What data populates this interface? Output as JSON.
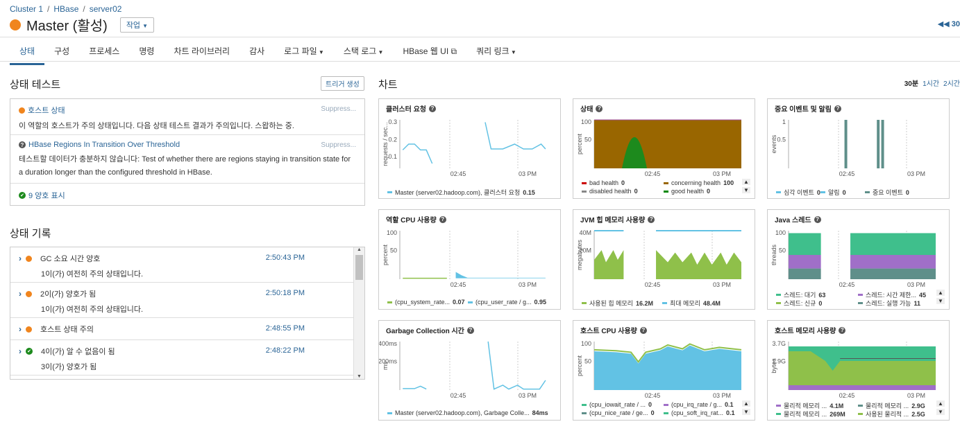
{
  "breadcrumb": [
    "Cluster 1",
    "HBase",
    "server02"
  ],
  "page_title": "Master (활성)",
  "action_button": "작업",
  "top_right_text": "30",
  "tabs": [
    {
      "label": "상태",
      "active": true,
      "caret": false
    },
    {
      "label": "구성",
      "caret": false
    },
    {
      "label": "프로세스",
      "caret": false
    },
    {
      "label": "명령",
      "caret": false
    },
    {
      "label": "차트 라이브러리",
      "caret": false
    },
    {
      "label": "감사",
      "caret": false
    },
    {
      "label": "로그 파일",
      "caret": true
    },
    {
      "label": "스택 로그",
      "caret": true
    },
    {
      "label": "HBase 웹 UI",
      "caret": false,
      "external": true
    },
    {
      "label": "쿼리 링크",
      "caret": true
    }
  ],
  "health_tests": {
    "title": "상태 테스트",
    "trigger_button": "트리거 생성",
    "items": [
      {
        "name": "호스트 상태",
        "suppress": "Suppress...",
        "desc": "이 역할의 호스트가 주의 상태입니다. 다음 상태 테스트 결과가 주의입니다. 스왑하는 중."
      },
      {
        "name": "HBase Regions In Transition Over Threshold",
        "suppress": "Suppress...",
        "desc": "테스트할 데이터가 충분하지 않습니다: Test of whether there are regions staying in transition state for a duration longer than the configured threshold in HBase."
      }
    ],
    "good_link": "9 양호 표시"
  },
  "health_history": {
    "title": "상태 기록",
    "rows": [
      {
        "status": "orange",
        "line1": "GC 소요 시간 양호",
        "line2": "1이(가) 여전히 주의 상태입니다.",
        "time": "2:50:43 PM"
      },
      {
        "status": "orange",
        "line1": "2이(가) 양호가 됨",
        "line2": "1이(가) 여전히 주의 상태입니다.",
        "time": "2:50:18 PM"
      },
      {
        "status": "orange",
        "line1": "호스트 상태 주의",
        "line2": "",
        "time": "2:48:55 PM"
      },
      {
        "status": "green",
        "line1": "4이(가) 알 수 없음이 됨",
        "line2": "3이(가) 양호가 됨",
        "time": "2:48:22 PM"
      }
    ]
  },
  "charts_section": {
    "title": "차트",
    "ranges": [
      "30분",
      "1시간",
      "2시간"
    ],
    "active_range": "30분"
  },
  "colors": {
    "accent": "#2a6496",
    "warning": "#f0851e",
    "good": "#1d8a1d",
    "series_blue": "#62c2e4",
    "series_green": "#8fc04a",
    "series_teal": "#3fbf8c",
    "series_purple": "#a06fc8",
    "concerning": "#996600"
  },
  "charts": [
    {
      "title": "클러스터 요청",
      "ylabel": "requests / sec...",
      "yticks": [
        "0.3",
        "0.2",
        "0.1"
      ],
      "xticks": [
        "02:45",
        "03 PM"
      ],
      "legend": [
        {
          "label": "Master (server02.hadoop.com), 클러스터 요청",
          "value": "0.15",
          "color": "#62c2e4"
        }
      ]
    },
    {
      "title": "상태",
      "ylabel": "percent",
      "yticks": [
        "100",
        "50"
      ],
      "xticks": [
        "02:45",
        "03 PM"
      ],
      "legend": [
        {
          "label": "bad health",
          "value": "0",
          "color": "#cc0000"
        },
        {
          "label": "concerning health",
          "value": "100",
          "color": "#996600"
        },
        {
          "label": "disabled health",
          "value": "0",
          "color": "#888888"
        },
        {
          "label": "good health",
          "value": "0",
          "color": "#008800"
        }
      ]
    },
    {
      "title": "중요 이벤트 및 알림",
      "ylabel": "events",
      "yticks": [
        "1",
        "0.5"
      ],
      "xticks": [
        "02:45",
        "03 PM"
      ],
      "legend": [
        {
          "label": "심각 이벤트",
          "value": "0",
          "color": "#62c2e4"
        },
        {
          "label": "알림",
          "value": "0",
          "color": "#62c2e4"
        },
        {
          "label": "중요 이벤트",
          "value": "0",
          "color": "#5f8f8a"
        }
      ]
    },
    {
      "title": "역할 CPU 사용량",
      "ylabel": "percent",
      "yticks": [
        "100",
        "50"
      ],
      "xticks": [
        "02:45",
        "03 PM"
      ],
      "legend": [
        {
          "label": "(cpu_system_rate...",
          "value": "0.07",
          "color": "#8fc04a"
        },
        {
          "label": "(cpu_user_rate / g...",
          "value": "0.95",
          "color": "#62c2e4"
        }
      ]
    },
    {
      "title": "JVM 힙 메모리 사용량",
      "ylabel": "megabytes",
      "yticks": [
        "40M",
        "20M"
      ],
      "xticks": [
        "02:45",
        "03 PM"
      ],
      "legend": [
        {
          "label": "사용된 힙 메모리",
          "value": "16.2M",
          "color": "#8fc04a"
        },
        {
          "label": "최대 메모리",
          "value": "48.4M",
          "color": "#62c2e4"
        }
      ]
    },
    {
      "title": "Java 스레드",
      "ylabel": "threads",
      "yticks": [
        "100",
        "50"
      ],
      "xticks": [
        "02:45",
        "03 PM"
      ],
      "legend": [
        {
          "label": "스레드: 대기",
          "value": "63",
          "color": "#3fbf8c"
        },
        {
          "label": "스레드: 시간 제한...",
          "value": "45",
          "color": "#a06fc8"
        },
        {
          "label": "스레드: 신규",
          "value": "0",
          "color": "#8fc04a"
        },
        {
          "label": "스레드: 실행 가능",
          "value": "11",
          "color": "#5f8f8a"
        }
      ]
    },
    {
      "title": "Garbage Collection 시간",
      "ylabel": "ms",
      "yticks": [
        "400ms",
        "200ms"
      ],
      "xticks": [
        "02:45",
        "03 PM"
      ],
      "legend": [
        {
          "label": "Master (server02.hadoop.com), Garbage Colle...",
          "value": "84ms",
          "color": "#62c2e4"
        }
      ]
    },
    {
      "title": "호스트 CPU 사용량",
      "ylabel": "percent",
      "yticks": [
        "100",
        "50"
      ],
      "xticks": [
        "02:45",
        "03 PM"
      ],
      "legend": [
        {
          "label": "(cpu_iowait_rate / ...",
          "value": "0",
          "color": "#3fbf8c"
        },
        {
          "label": "(cpu_irq_rate / g...",
          "value": "0.1",
          "color": "#a06fc8"
        },
        {
          "label": "(cpu_nice_rate / ge...",
          "value": "0",
          "color": "#5f8f8a"
        },
        {
          "label": "(cpu_soft_irq_rat...",
          "value": "0.1",
          "color": "#3fbf8c"
        }
      ]
    },
    {
      "title": "호스트 메모리 사용량",
      "ylabel": "bytes",
      "yticks": [
        "3.7G",
        "1.9G"
      ],
      "xticks": [
        "02:45",
        "03 PM"
      ],
      "legend": [
        {
          "label": "물리적 메모리 ...",
          "value": "4.1M",
          "color": "#a06fc8"
        },
        {
          "label": "물리적 메모리 ...",
          "value": "2.9G",
          "color": "#5f8f8a"
        },
        {
          "label": "물리적 메모리 ...",
          "value": "269M",
          "color": "#3fbf8c"
        },
        {
          "label": "사용된 물리적 ...",
          "value": "2.5G",
          "color": "#8fc04a"
        }
      ]
    }
  ]
}
